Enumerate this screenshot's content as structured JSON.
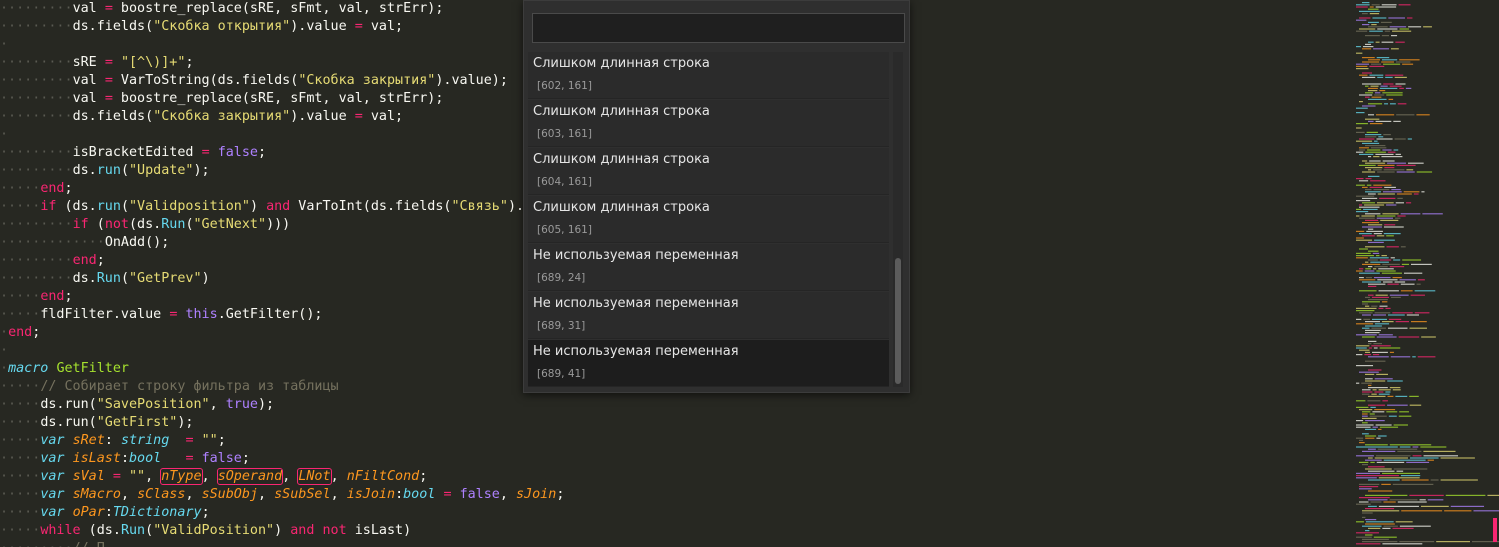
{
  "editor": {
    "code_lines": [
      {
        "indent": 2,
        "tokens": [
          [
            "",
            "val "
          ],
          [
            "kw",
            "="
          ],
          [
            "",
            " boostre_replace(sRE, sFmt, val, strErr);"
          ]
        ]
      },
      {
        "indent": 2,
        "tokens": [
          [
            "",
            "ds.fields("
          ],
          [
            "str",
            "\"Скобка открытия\""
          ],
          [
            "",
            ").value "
          ],
          [
            "kw",
            "="
          ],
          [
            "",
            " val;"
          ]
        ]
      },
      {
        "indent": 0,
        "tokens": []
      },
      {
        "indent": 2,
        "tokens": [
          [
            "",
            "sRE "
          ],
          [
            "kw",
            "="
          ],
          [
            "",
            " "
          ],
          [
            "str",
            "\"[^\\)]+\""
          ],
          [
            "",
            ";"
          ]
        ]
      },
      {
        "indent": 2,
        "tokens": [
          [
            "",
            "val "
          ],
          [
            "kw",
            "="
          ],
          [
            "",
            " VarToString(ds.fields("
          ],
          [
            "str",
            "\"Скобка закрытия\""
          ],
          [
            "",
            ").value);"
          ]
        ]
      },
      {
        "indent": 2,
        "tokens": [
          [
            "",
            "val "
          ],
          [
            "kw",
            "="
          ],
          [
            "",
            " boostre_replace(sRE, sFmt, val, strErr);"
          ]
        ]
      },
      {
        "indent": 2,
        "tokens": [
          [
            "",
            "ds.fields("
          ],
          [
            "str",
            "\"Скобка закрытия\""
          ],
          [
            "",
            ").value "
          ],
          [
            "kw",
            "="
          ],
          [
            "",
            " val;"
          ]
        ]
      },
      {
        "indent": 0,
        "tokens": []
      },
      {
        "indent": 2,
        "tokens": [
          [
            "",
            "isBracketEdited "
          ],
          [
            "kw",
            "="
          ],
          [
            "",
            " "
          ],
          [
            "const",
            "false"
          ],
          [
            "",
            ";"
          ]
        ]
      },
      {
        "indent": 2,
        "tokens": [
          [
            "",
            "ds."
          ],
          [
            "fn",
            "run"
          ],
          [
            "",
            "("
          ],
          [
            "str",
            "\"Update\""
          ],
          [
            "",
            ");"
          ]
        ]
      },
      {
        "indent": 1,
        "tokens": [
          [
            "kw",
            "end"
          ],
          [
            "",
            ";"
          ]
        ]
      },
      {
        "indent": 1,
        "tokens": [
          [
            "kw",
            "if"
          ],
          [
            "",
            " (ds."
          ],
          [
            "fn",
            "run"
          ],
          [
            "",
            "("
          ],
          [
            "str",
            "\"Validposition\""
          ],
          [
            "",
            ") "
          ],
          [
            "kw",
            "and"
          ],
          [
            "",
            " VarToInt(ds.fields("
          ],
          [
            "str",
            "\"Связь\""
          ],
          [
            "",
            ")."
          ]
        ]
      },
      {
        "indent": 2,
        "tokens": [
          [
            "kw",
            "if"
          ],
          [
            "",
            " ("
          ],
          [
            "kw",
            "not"
          ],
          [
            "",
            "(ds."
          ],
          [
            "fn",
            "Run"
          ],
          [
            "",
            "("
          ],
          [
            "str",
            "\"GetNext\""
          ],
          [
            "",
            ")))"
          ]
        ]
      },
      {
        "indent": 3,
        "tokens": [
          [
            "",
            "OnAdd();"
          ]
        ]
      },
      {
        "indent": 2,
        "tokens": [
          [
            "kw",
            "end"
          ],
          [
            "",
            ";"
          ]
        ]
      },
      {
        "indent": 2,
        "tokens": [
          [
            "",
            "ds."
          ],
          [
            "fn",
            "Run"
          ],
          [
            "",
            "("
          ],
          [
            "str",
            "\"GetPrev\""
          ],
          [
            "",
            ")"
          ]
        ]
      },
      {
        "indent": 1,
        "tokens": [
          [
            "kw",
            "end"
          ],
          [
            "",
            ";"
          ]
        ]
      },
      {
        "indent": 1,
        "tokens": [
          [
            "",
            "fldFilter.value "
          ],
          [
            "kw",
            "="
          ],
          [
            "",
            " "
          ],
          [
            "const",
            "this"
          ],
          [
            "",
            ".GetFilter();"
          ]
        ]
      },
      {
        "indent": 0,
        "tokens": [
          [
            "kw",
            "end"
          ],
          [
            "",
            ";"
          ]
        ]
      },
      {
        "indent": 0,
        "tokens": []
      },
      {
        "indent": 0,
        "tokens": [
          [
            "typ",
            "macro"
          ],
          [
            "",
            " "
          ],
          [
            "def",
            "GetFilter"
          ]
        ]
      },
      {
        "indent": 1,
        "tokens": [
          [
            "cmt",
            "// Собирает строку фильтра из таблицы"
          ]
        ]
      },
      {
        "indent": 1,
        "tokens": [
          [
            "",
            "ds.run("
          ],
          [
            "str",
            "\"SavePosition\""
          ],
          [
            "",
            ", "
          ],
          [
            "const",
            "true"
          ],
          [
            "",
            ");"
          ]
        ]
      },
      {
        "indent": 1,
        "tokens": [
          [
            "",
            "ds.run("
          ],
          [
            "str",
            "\"GetFirst\""
          ],
          [
            "",
            ");"
          ]
        ]
      },
      {
        "indent": 1,
        "tokens": [
          [
            "typ",
            "var"
          ],
          [
            "",
            " "
          ],
          [
            "param",
            "sRet"
          ],
          [
            "",
            ": "
          ],
          [
            "typ",
            "string"
          ],
          [
            "",
            "  "
          ],
          [
            "kw",
            "="
          ],
          [
            "",
            " "
          ],
          [
            "str",
            "\"\""
          ],
          [
            "",
            ";"
          ]
        ]
      },
      {
        "indent": 1,
        "tokens": [
          [
            "typ",
            "var"
          ],
          [
            "",
            " "
          ],
          [
            "param",
            "isLast"
          ],
          [
            "",
            ":"
          ],
          [
            "typ",
            "bool"
          ],
          [
            "",
            "   "
          ],
          [
            "kw",
            "="
          ],
          [
            "",
            " "
          ],
          [
            "const",
            "false"
          ],
          [
            "",
            ";"
          ]
        ]
      },
      {
        "indent": 1,
        "tokens": [
          [
            "typ",
            "var"
          ],
          [
            "",
            " "
          ],
          [
            "param",
            "sVal"
          ],
          [
            "",
            " "
          ],
          [
            "kw",
            "="
          ],
          [
            "",
            " "
          ],
          [
            "str",
            "\"\""
          ],
          [
            "",
            ", "
          ],
          [
            "param err",
            "nType"
          ],
          [
            "",
            ", "
          ],
          [
            "param err",
            "sOperand"
          ],
          [
            "",
            ", "
          ],
          [
            "param err",
            "LNot"
          ],
          [
            "",
            ", "
          ],
          [
            "param",
            "nFiltCond"
          ],
          [
            "",
            ";"
          ]
        ]
      },
      {
        "indent": 1,
        "tokens": [
          [
            "typ",
            "var"
          ],
          [
            "",
            " "
          ],
          [
            "param",
            "sMacro"
          ],
          [
            "",
            ", "
          ],
          [
            "param",
            "sClass"
          ],
          [
            "",
            ", "
          ],
          [
            "param",
            "sSubObj"
          ],
          [
            "",
            ", "
          ],
          [
            "param",
            "sSubSel"
          ],
          [
            "",
            ", "
          ],
          [
            "param",
            "isJoin"
          ],
          [
            "",
            ":"
          ],
          [
            "typ",
            "bool"
          ],
          [
            "",
            " "
          ],
          [
            "kw",
            "="
          ],
          [
            "",
            " "
          ],
          [
            "const",
            "false"
          ],
          [
            "",
            ", "
          ],
          [
            "param",
            "sJoin"
          ],
          [
            "",
            ";"
          ]
        ]
      },
      {
        "indent": 1,
        "tokens": [
          [
            "typ",
            "var"
          ],
          [
            "",
            " "
          ],
          [
            "param",
            "oPar"
          ],
          [
            "",
            ":"
          ],
          [
            "typ",
            "TDictionary"
          ],
          [
            "",
            ";"
          ]
        ]
      },
      {
        "indent": 1,
        "tokens": [
          [
            "kw",
            "while"
          ],
          [
            "",
            " (ds."
          ],
          [
            "fn",
            "Run"
          ],
          [
            "",
            "("
          ],
          [
            "str",
            "\"ValidPosition\""
          ],
          [
            "",
            ") "
          ],
          [
            "kw",
            "and"
          ],
          [
            "",
            " "
          ],
          [
            "kw",
            "not"
          ],
          [
            "",
            " isLast)"
          ]
        ]
      },
      {
        "indent": 2,
        "tokens": [
          [
            "cmt",
            "// П"
          ]
        ]
      }
    ]
  },
  "quick_panel": {
    "search_value": "",
    "items": [
      {
        "title": "Слишком длинная строка",
        "subtitle": "[602, 161]",
        "selected": false
      },
      {
        "title": "Слишком длинная строка",
        "subtitle": "[603, 161]",
        "selected": false
      },
      {
        "title": "Слишком длинная строка",
        "subtitle": "[604, 161]",
        "selected": false
      },
      {
        "title": "Слишком длинная строка",
        "subtitle": "[605, 161]",
        "selected": false
      },
      {
        "title": "Не используемая переменная",
        "subtitle": "[689, 24]",
        "selected": false
      },
      {
        "title": "Не используемая переменная",
        "subtitle": "[689, 31]",
        "selected": false
      },
      {
        "title": "Не используемая переменная",
        "subtitle": "[689, 41]",
        "selected": true
      }
    ]
  },
  "colors": {
    "background": "#272822",
    "keyword": "#f92672",
    "string": "#e6db74",
    "constant": "#ae81ff",
    "function": "#66d9ef",
    "definition": "#a6e22e",
    "comment": "#75715e"
  }
}
